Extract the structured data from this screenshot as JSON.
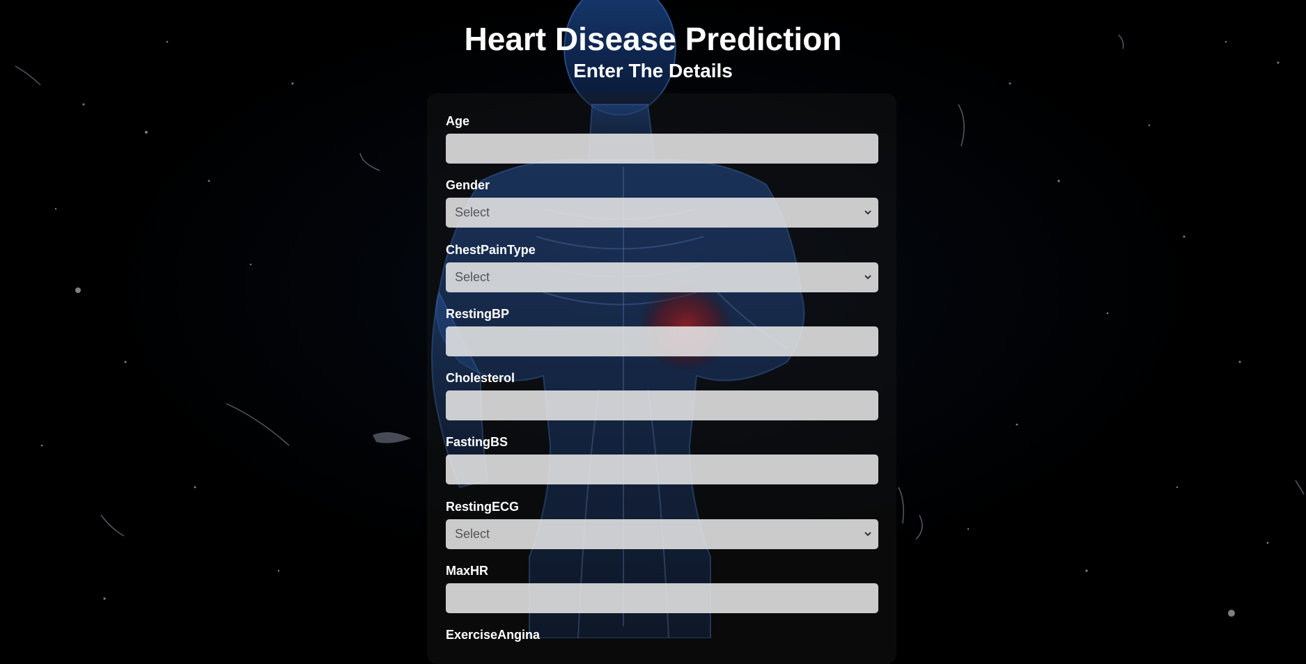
{
  "header": {
    "title": "Heart Disease Prediction",
    "subtitle": "Enter The Details"
  },
  "form": {
    "fields": [
      {
        "label": "Age",
        "type": "input",
        "value": ""
      },
      {
        "label": "Gender",
        "type": "select",
        "value": "Select"
      },
      {
        "label": "ChestPainType",
        "type": "select",
        "value": "Select"
      },
      {
        "label": "RestingBP",
        "type": "input",
        "value": ""
      },
      {
        "label": "Cholesterol",
        "type": "input",
        "value": ""
      },
      {
        "label": "FastingBS",
        "type": "input",
        "value": ""
      },
      {
        "label": "RestingECG",
        "type": "select",
        "value": "Select"
      },
      {
        "label": "MaxHR",
        "type": "input",
        "value": ""
      },
      {
        "label": "ExerciseAngina",
        "type": "select",
        "value": ""
      }
    ]
  },
  "colors": {
    "background": "#000000",
    "body_glow": "#1a4c9c",
    "heart": "#c0202a",
    "field_bg": "#e6e6e6"
  }
}
